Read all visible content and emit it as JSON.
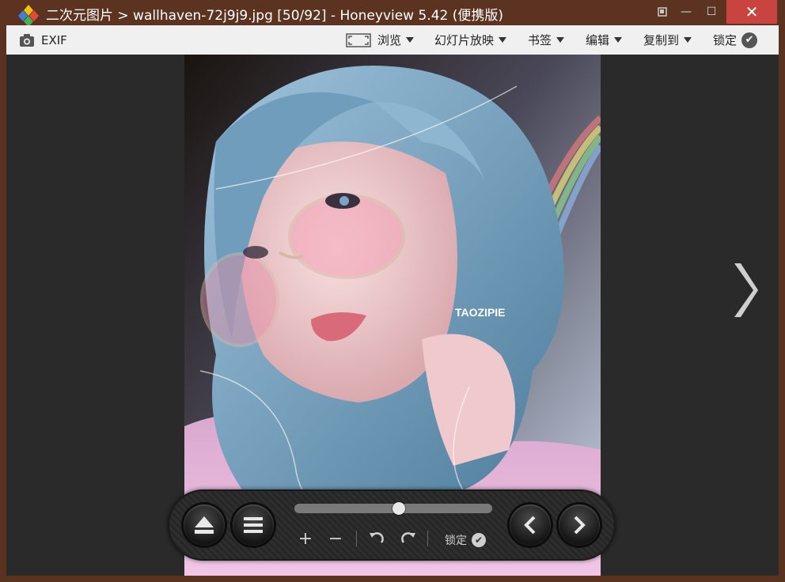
{
  "window": {
    "title": "二次元图片 > wallhaven-72j9j9.jpg [50/92] - Honeyview 5.42 (便携版)",
    "controls": {
      "close": "✕",
      "minimize": "—",
      "restore": "☐"
    }
  },
  "toolbar": {
    "exif_label": "EXIF",
    "browse_label": "浏览",
    "slideshow_label": "幻灯片放映",
    "bookmark_label": "书签",
    "edit_label": "编辑",
    "copyto_label": "复制到",
    "lock_label": "锁定"
  },
  "image": {
    "watermark": "TAOZIPIE"
  },
  "controlbar": {
    "lock_label": "锁定",
    "slider_position": 0.53,
    "zoom_in": "+",
    "zoom_out": "−"
  },
  "colors": {
    "titlebar": "#5b3320",
    "close_button": "#c9443e",
    "toolbar": "#f0f0f0",
    "viewer_bg": "#2a2a2a"
  }
}
